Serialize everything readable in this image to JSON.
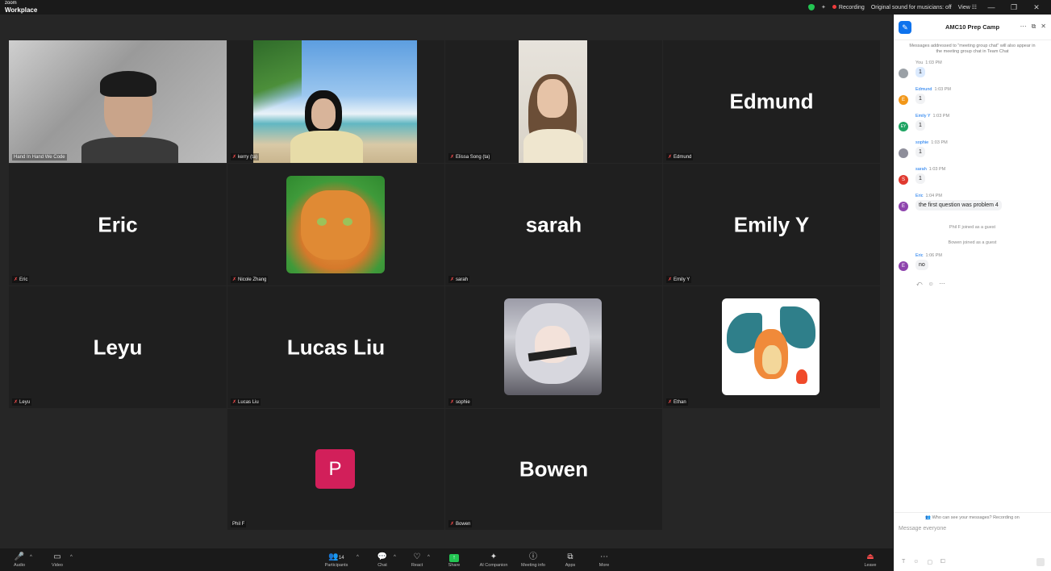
{
  "app": {
    "brand_line1": "zoom",
    "brand_line2": "Workplace"
  },
  "topbar": {
    "recording": "Recording",
    "sound": "Original sound for musicians: off",
    "view": "View"
  },
  "tiles": [
    {
      "name": "Hand In Hand We Code"
    },
    {
      "name": "kerry (ta)"
    },
    {
      "name": "Elissa Song (ta)"
    },
    {
      "name": "Edmund",
      "display": "Edmund"
    },
    {
      "name": "Eric",
      "display": "Eric"
    },
    {
      "name": "Nicole Zhang"
    },
    {
      "name": "sarah",
      "display": "sarah"
    },
    {
      "name": "Emily Y",
      "display": "Emily Y"
    },
    {
      "name": "Leyu",
      "display": "Leyu"
    },
    {
      "name": "Lucas Liu",
      "display": "Lucas Liu"
    },
    {
      "name": "sophie"
    },
    {
      "name": "Ethan"
    },
    {
      "name": "Phil F",
      "initial": "P"
    },
    {
      "name": "Bowen",
      "display": "Bowen"
    }
  ],
  "chat": {
    "title": "AMC10 Prep Camp",
    "notice": "Messages addressed to \"meeting group chat\" will also appear in the meeting group chat in Team Chat",
    "messages": [
      {
        "who": "You",
        "time": "1:03 PM",
        "text": "1",
        "initial": "",
        "color": "#9aa0a6"
      },
      {
        "who": "Edmund",
        "time": "1:03 PM",
        "text": "1",
        "initial": "E",
        "color": "#f29718"
      },
      {
        "who": "Emily Y",
        "time": "1:03 PM",
        "text": "1",
        "initial": "EY",
        "color": "#1fa463"
      },
      {
        "who": "sophie",
        "time": "1:03 PM",
        "text": "1",
        "initial": "",
        "color": "#8e8e9a"
      },
      {
        "who": "sarah",
        "time": "1:03 PM",
        "text": "1",
        "initial": "S",
        "color": "#e0392f"
      },
      {
        "who": "Eric",
        "time": "1:04 PM",
        "text": "the first question was problem 4",
        "initial": "E",
        "color": "#8e44ad"
      },
      {
        "who": "Eric",
        "time": "1:06 PM",
        "text": "no",
        "initial": "E",
        "color": "#8e44ad"
      }
    ],
    "sys1": "Phil F joined as a guest",
    "sys2": "Bowen joined as a guest",
    "visibility": "Who can see your messages? Recording on",
    "placeholder": "Message everyone"
  },
  "toolbar": {
    "audio": "Audio",
    "video": "Video",
    "participants": "Participants",
    "participants_count": "14",
    "chat": "Chat",
    "react": "React",
    "share": "Share",
    "ai": "AI Companion",
    "info": "Meeting info",
    "apps": "Apps",
    "more": "More",
    "leave": "Leave"
  },
  "colors": {
    "accent": "#0e72ed",
    "active_speaker": "#32d46e",
    "share": "#23c552",
    "muted": "#ff4d4d"
  }
}
